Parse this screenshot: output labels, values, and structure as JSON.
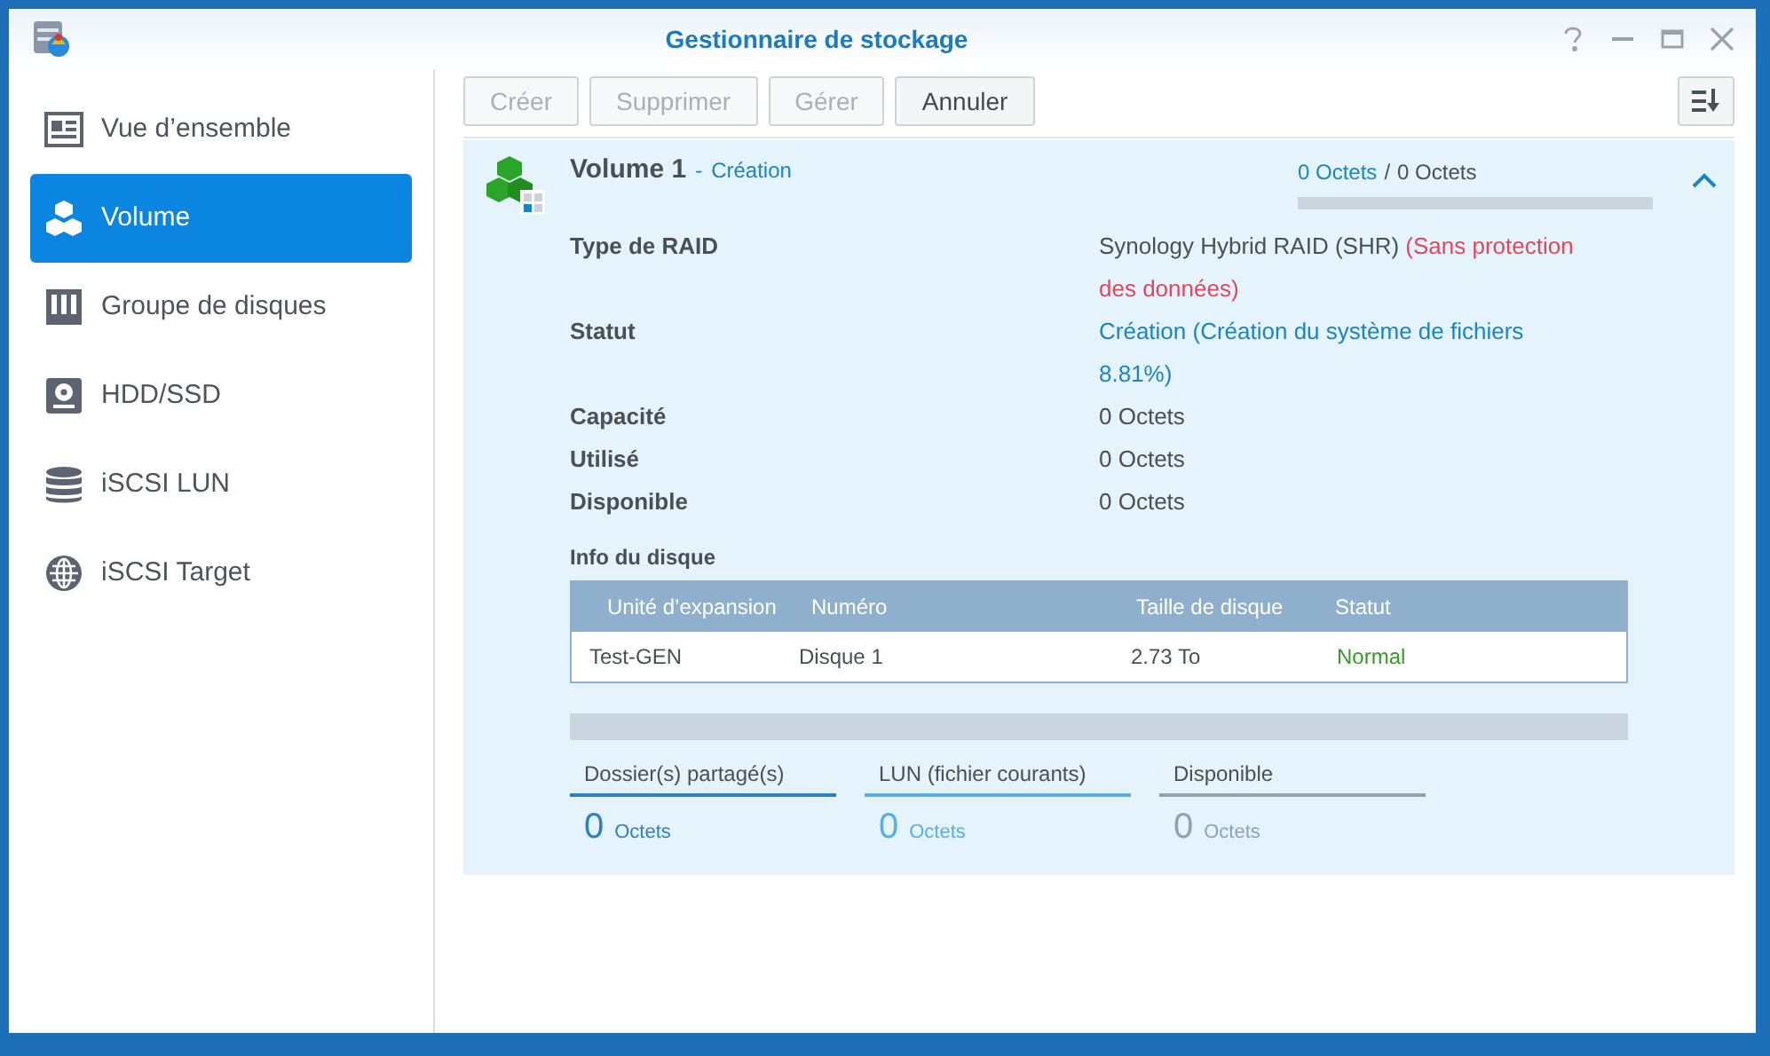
{
  "window": {
    "title": "Gestionnaire de stockage"
  },
  "sidebar": {
    "items": [
      {
        "label": "Vue d’ensemble",
        "kind": "overview",
        "selected": false
      },
      {
        "label": "Volume",
        "kind": "volume",
        "selected": true
      },
      {
        "label": "Groupe de disques",
        "kind": "group",
        "selected": false
      },
      {
        "label": "HDD/SSD",
        "kind": "disk",
        "selected": false
      },
      {
        "label": "iSCSI LUN",
        "kind": "lun",
        "selected": false
      },
      {
        "label": "iSCSI Target",
        "kind": "target",
        "selected": false
      }
    ]
  },
  "toolbar": {
    "buttons": [
      {
        "label": "Créer",
        "disabled": true
      },
      {
        "label": "Supprimer",
        "disabled": true
      },
      {
        "label": "Gérer",
        "disabled": true
      },
      {
        "label": "Annuler",
        "disabled": false
      }
    ]
  },
  "volume": {
    "name": "Volume 1",
    "separator": "-",
    "state": "Création",
    "expanded": true,
    "usage": {
      "used": "0 Octets",
      "separator": "/",
      "total": "0 Octets",
      "level": 0
    },
    "details": [
      {
        "label": "Type de RAID",
        "value": [
          {
            "text": "Synology Hybrid RAID (SHR)",
            "kind": "normal"
          },
          {
            "text": "(Sans protection des données)",
            "kind": "danger"
          }
        ]
      },
      {
        "label": "Statut",
        "value": [
          {
            "text": "Création",
            "kind": "link"
          },
          {
            "text": "(Création du système de fichiers 8.81%)",
            "kind": "link"
          }
        ]
      },
      {
        "label": "Capacité",
        "value": [
          {
            "text": "0 Octets",
            "kind": "normal"
          }
        ]
      },
      {
        "label": "Utilisé",
        "value": [
          {
            "text": "0 Octets",
            "kind": "normal"
          }
        ]
      },
      {
        "label": "Disponible",
        "value": [
          {
            "text": "0 Octets",
            "kind": "normal"
          }
        ]
      }
    ],
    "disk_info": {
      "title": "Info du disque",
      "columns": [
        "Unité d’expansion",
        "Numéro",
        "Taille de disque",
        "Statut"
      ],
      "rows": [
        {
          "cells": [
            "Test-GEN",
            "Disque 1",
            "2.73 To",
            "Normal"
          ],
          "color": "#3a9a2a"
        }
      ]
    },
    "allocation": {
      "level": 0,
      "legend": [
        {
          "label": "Dossier(s) partagé(s)",
          "value": "0",
          "unit": "Octets",
          "color": "#2f7fc1"
        },
        {
          "label": "LUN (fichier courants)",
          "value": "0",
          "unit": "Octets",
          "color": "#55b0e4"
        },
        {
          "label": "Disponible",
          "value": "0",
          "unit": "Octets",
          "color": "#8fa2b2"
        }
      ]
    }
  }
}
